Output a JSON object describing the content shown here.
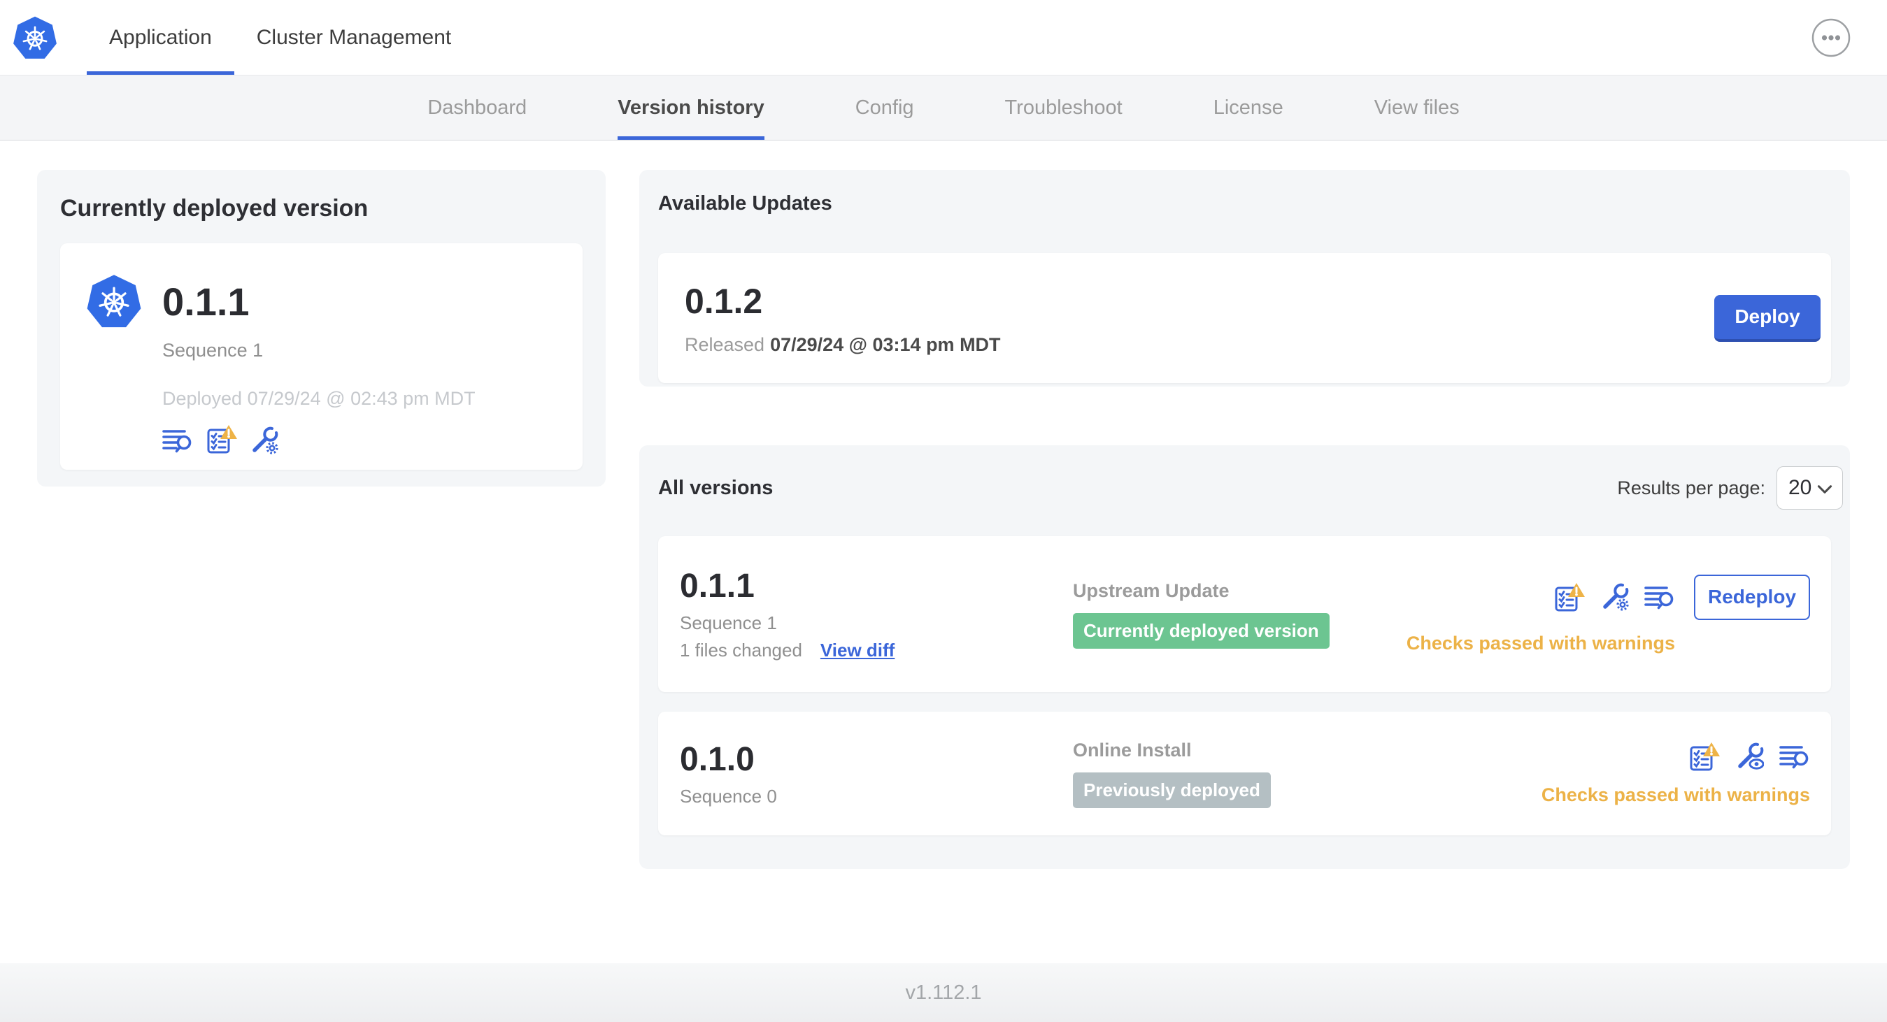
{
  "header": {
    "tabs": [
      {
        "label": "Application",
        "active": true
      },
      {
        "label": "Cluster Management",
        "active": false
      }
    ],
    "more_icon": "ellipsis-icon"
  },
  "subnav": {
    "items": [
      "Dashboard",
      "Version history",
      "Config",
      "Troubleshoot",
      "License",
      "View files"
    ],
    "active": "Version history"
  },
  "current_version": {
    "title": "Currently deployed version",
    "app_icon": "kubernetes-logo",
    "version": "0.1.1",
    "sequence": "Sequence 1",
    "deployed": "Deployed 07/29/24 @ 02:43 pm MDT",
    "icons": [
      "release-notes-icon",
      "preflight-warning-icon",
      "config-gear-icon"
    ]
  },
  "available_updates": {
    "title": "Available Updates",
    "version": "0.1.2",
    "released_prefix": "Released",
    "released_date": "07/29/24 @ 03:14 pm MDT",
    "deploy_label": "Deploy"
  },
  "all_versions": {
    "title": "All versions",
    "results_per_page_label": "Results per page:",
    "results_per_page_value": "20",
    "rows": [
      {
        "version": "0.1.1",
        "sequence": "Sequence 1",
        "files_changed": "1 files changed",
        "view_diff": "View diff",
        "source": "Upstream Update",
        "badge": "Currently deployed version",
        "badge_color": "#6cc591",
        "icons": [
          "preflight-warning-icon",
          "config-gear-icon",
          "release-notes-icon"
        ],
        "action": "Redeploy",
        "status": "Checks passed with warnings"
      },
      {
        "version": "0.1.0",
        "sequence": "Sequence 0",
        "source": "Online Install",
        "badge": "Previously deployed",
        "badge_color": "#b4bfc3",
        "icons": [
          "preflight-warning-icon",
          "config-eye-icon",
          "release-notes-icon"
        ],
        "status": "Checks passed with warnings"
      }
    ]
  },
  "footer": {
    "version": "v1.112.1"
  },
  "colors": {
    "primary_blue": "#3b66d9",
    "logo_blue": "#326ce5",
    "badge_green": "#6cc591",
    "badge_gray": "#b4bfc3",
    "warning_amber": "#ecb247",
    "card_gray": "#f4f6f8",
    "subnav_gray": "#f4f5f7"
  }
}
